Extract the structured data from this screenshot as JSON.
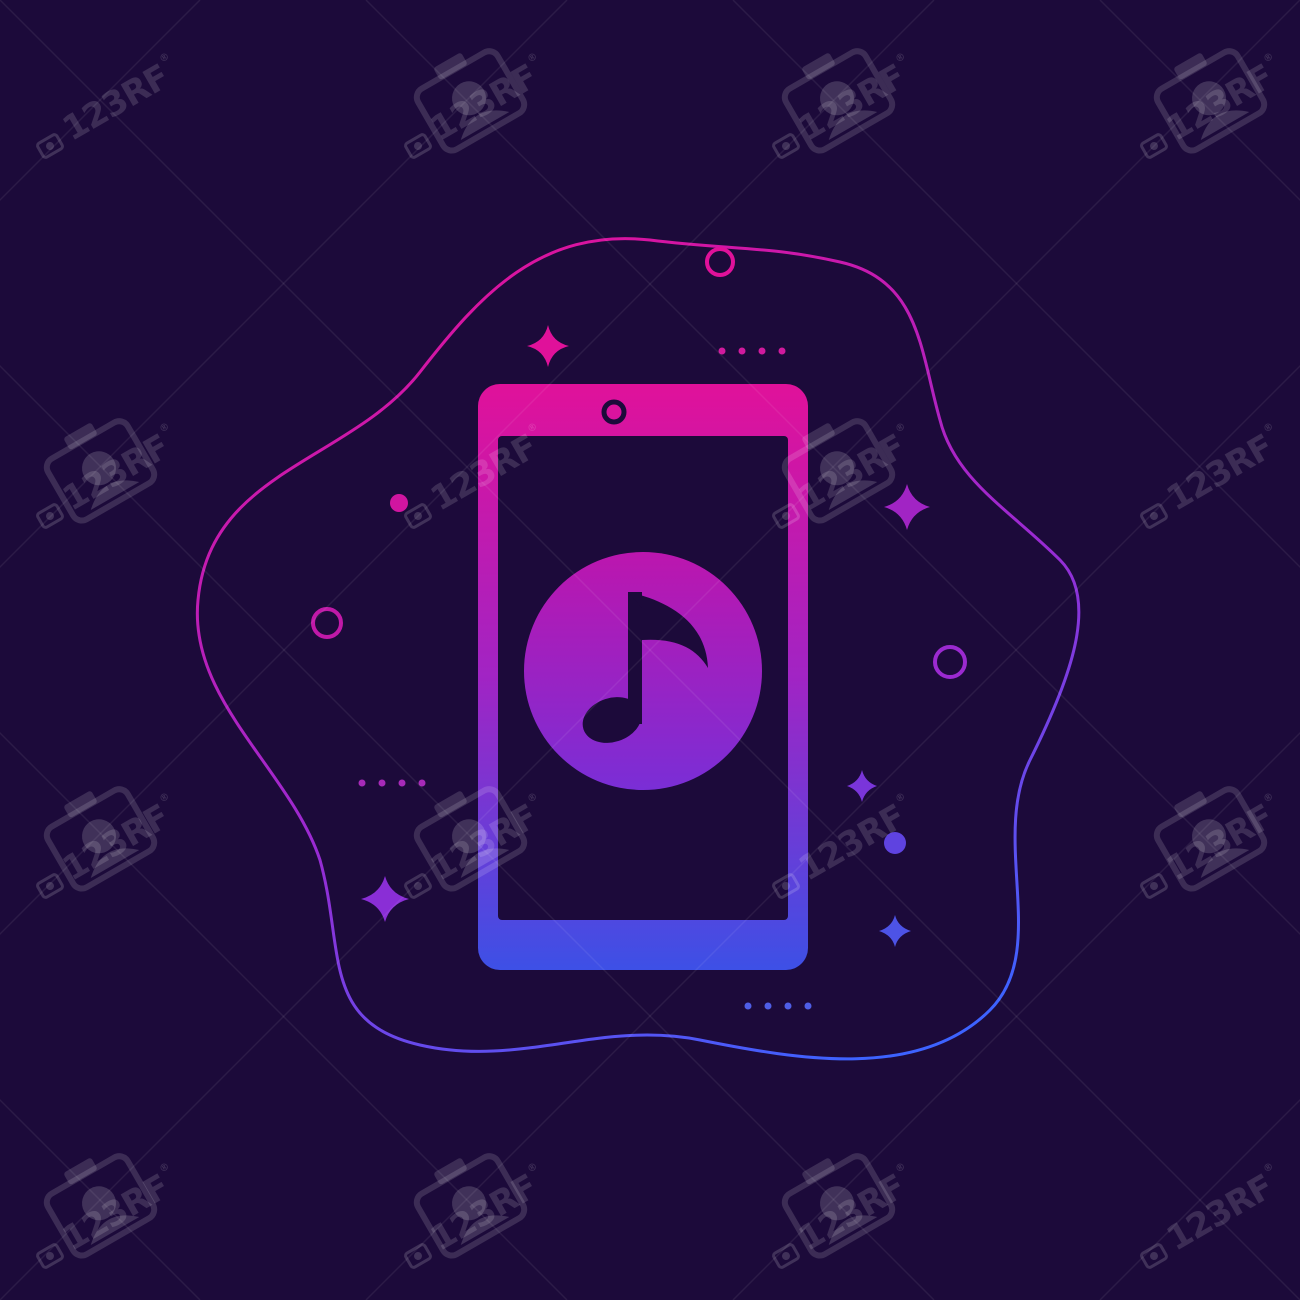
{
  "illustration": {
    "subject": "smartphone-music-app",
    "background_color": "#1c0a3a",
    "gradient_top": "#e0119a",
    "gradient_mid": "#a124c4",
    "gradient_bottom": "#3d50e6",
    "screen_color": "#1c0a3a",
    "phone_icon": "smartphone-icon",
    "center_icon": "music-note-icon",
    "decor_icons": [
      "sparkle-icon",
      "ring-icon",
      "dot-icon",
      "dotted-dash-icon"
    ]
  },
  "watermark": {
    "text": "123RF",
    "registered_mark": "®",
    "icon": "camera-icon",
    "tile_icon": "camera-watermark-icon",
    "opacity": 0.14
  }
}
